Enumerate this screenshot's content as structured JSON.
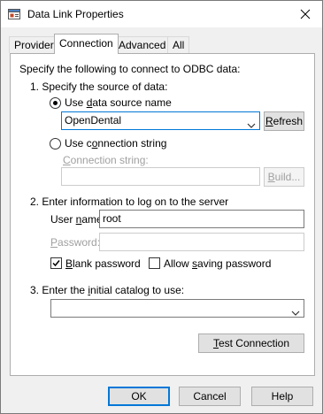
{
  "window": {
    "title": "Data Link Properties"
  },
  "tabs": [
    {
      "label": "Provider"
    },
    {
      "label": "Connection"
    },
    {
      "label": "Advanced"
    },
    {
      "label": "All"
    }
  ],
  "connection": {
    "intro": "Specify the following to connect to ODBC data:",
    "step1": "1. Specify the source of data:",
    "use_dsn_prefix": "Use ",
    "use_dsn_underlined": "d",
    "use_dsn_suffix": "ata source name",
    "dsn_value": "OpenDental",
    "refresh_underlined": "R",
    "refresh_suffix": "efresh",
    "use_conn_prefix": "Use c",
    "use_conn_underlined": "o",
    "use_conn_suffix": "nnection string",
    "conn_label_prefix": "",
    "conn_label_underlined": "C",
    "conn_label_suffix": "onnection string:",
    "conn_value": "",
    "build_underlined": "B",
    "build_suffix": "uild...",
    "step2": "2. Enter information to log on to the server",
    "user_prefix": "User ",
    "user_underlined": "n",
    "user_suffix": "ame:",
    "user_value": "root",
    "password_underlined": "P",
    "password_suffix": "assword:",
    "password_value": "",
    "blank_underlined": "B",
    "blank_suffix": "lank password",
    "blank_checked": true,
    "allow_prefix": "Allow ",
    "allow_underlined": "s",
    "allow_suffix": "aving password",
    "allow_checked": false,
    "step3_prefix": "3. Enter the ",
    "step3_underlined": "i",
    "step3_suffix": "nitial catalog to use:",
    "catalog_value": "",
    "test_underlined": "T",
    "test_suffix": "est Connection"
  },
  "footer": {
    "ok_label": "OK",
    "cancel_label": "Cancel",
    "help_label": "Help"
  }
}
